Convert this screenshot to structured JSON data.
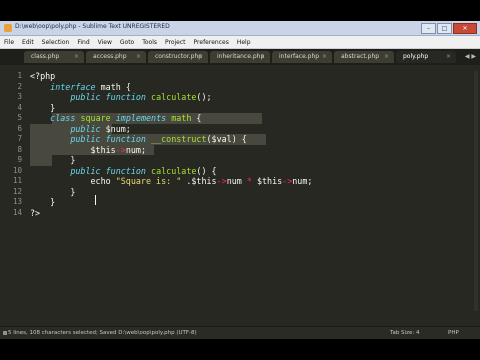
{
  "window": {
    "title": "D:\\web\\oop\\poly.php - Sublime Text UNREGISTERED",
    "buttons": {
      "minimize": "–",
      "maximize": "□",
      "close": "✕"
    }
  },
  "menu": [
    "File",
    "Edit",
    "Selection",
    "Find",
    "View",
    "Goto",
    "Tools",
    "Project",
    "Preferences",
    "Help"
  ],
  "tabs": [
    {
      "label": "class.php",
      "close": "×"
    },
    {
      "label": "access.php",
      "close": "×"
    },
    {
      "label": "constructor.php",
      "close": "×"
    },
    {
      "label": "inheritance.php",
      "close": "×"
    },
    {
      "label": "interface.php",
      "close": "×"
    },
    {
      "label": "abstract.php",
      "close": "×"
    },
    {
      "label": "poly.php",
      "close": "×",
      "active": true
    }
  ],
  "tab_arrows": "◀ ▶",
  "editor": {
    "line_numbers": [
      "1",
      "2",
      "3",
      "4",
      "5",
      "6",
      "7",
      "8",
      "9",
      "10",
      "11",
      "12",
      "13",
      "14"
    ],
    "lines": [
      [
        [
          "plain",
          "<?php"
        ]
      ],
      [
        [
          "k",
          "    interface"
        ],
        [
          "plain",
          " math {"
        ]
      ],
      [
        [
          "k",
          "        public"
        ],
        [
          "plain",
          " "
        ],
        [
          "k",
          "function"
        ],
        [
          "plain",
          " "
        ],
        [
          "fn",
          "calculate"
        ],
        [
          "plain",
          "();"
        ]
      ],
      [
        [
          "plain",
          "    }"
        ]
      ],
      [
        [
          "k",
          "    class"
        ],
        [
          "plain",
          " "
        ],
        [
          "fn",
          "square"
        ],
        [
          "plain",
          " "
        ],
        [
          "k",
          "implements"
        ],
        [
          "plain",
          " "
        ],
        [
          "fn",
          "math"
        ],
        [
          "plain",
          " {"
        ]
      ],
      [
        [
          "k",
          "        public"
        ],
        [
          "plain",
          " $num;"
        ]
      ],
      [
        [
          "k",
          "        public"
        ],
        [
          "plain",
          " "
        ],
        [
          "k",
          "function"
        ],
        [
          "plain",
          " "
        ],
        [
          "fn",
          "__construct"
        ],
        [
          "plain",
          "($val) {"
        ]
      ],
      [
        [
          "plain",
          "            $this"
        ],
        [
          "kw",
          "->"
        ],
        [
          "plain",
          "num;"
        ]
      ],
      [
        [
          "plain",
          "        }"
        ]
      ],
      [
        [
          "k",
          "        public"
        ],
        [
          "plain",
          " "
        ],
        [
          "k",
          "function"
        ],
        [
          "plain",
          " "
        ],
        [
          "fn",
          "calculate"
        ],
        [
          "plain",
          "() {"
        ]
      ],
      [
        [
          "plain",
          "            echo "
        ],
        [
          "st",
          "\"Square is: \""
        ],
        [
          "plain",
          " ."
        ],
        [
          "plain",
          "$this"
        ],
        [
          "kw",
          "->"
        ],
        [
          "plain",
          "num "
        ],
        [
          "kw",
          "*"
        ],
        [
          "plain",
          " $this"
        ],
        [
          "kw",
          "->"
        ],
        [
          "plain",
          "num;"
        ]
      ],
      [
        [
          "plain",
          "        }"
        ]
      ],
      [
        [
          "plain",
          "    }"
        ]
      ],
      [
        [
          "plain",
          "?>"
        ]
      ]
    ]
  },
  "status": {
    "message": "5 lines, 108 characters selected; Saved D:\\web\\oop\\poly.php (UTF-8)",
    "tab_size": "Tab Size: 4",
    "syntax": "PHP"
  },
  "colors": {
    "background": "#272822",
    "keyword": "#66d9ef",
    "operator": "#f92672",
    "function": "#a6e22e",
    "string": "#e6db74",
    "selection": "#49483e"
  }
}
